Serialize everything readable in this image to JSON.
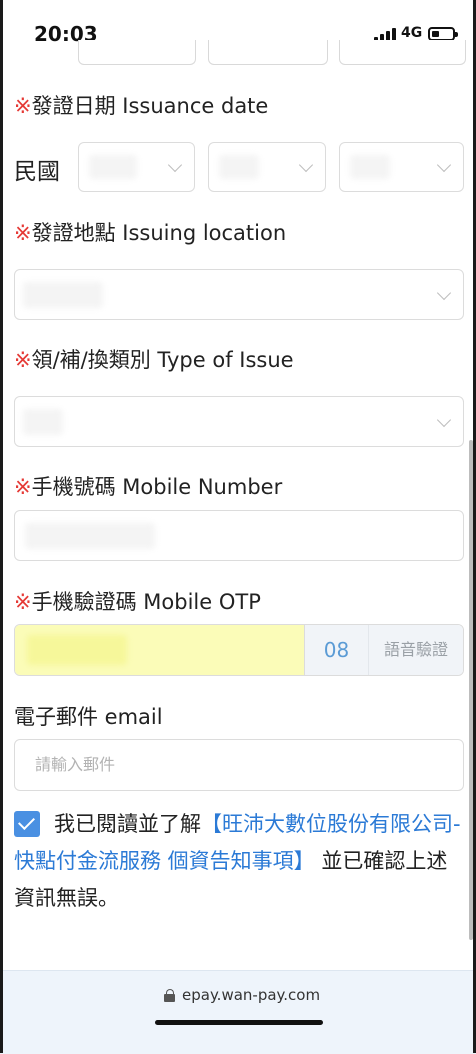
{
  "status_bar": {
    "time": "20:03",
    "network": "4G"
  },
  "form": {
    "issuance_date": {
      "required_mark": "※",
      "label": "發證日期 Issuance date",
      "era": "民國"
    },
    "issuing_location": {
      "required_mark": "※",
      "label": "發證地點 Issuing location"
    },
    "issue_type": {
      "required_mark": "※",
      "label": "領/補/換類別 Type of Issue"
    },
    "mobile_number": {
      "required_mark": "※",
      "label": "手機號碼 Mobile Number"
    },
    "mobile_otp": {
      "required_mark": "※",
      "label": "手機驗證碼 Mobile OTP",
      "countdown": "08",
      "voice_button": "語音驗證"
    },
    "email": {
      "label": "電子郵件 email",
      "placeholder": "請輸入郵件"
    },
    "consent": {
      "checked": true,
      "prefix": "我已閱讀並了解",
      "link": "【旺沛大數位股份有限公司-快點付金流服務 個資告知事項】",
      "suffix": " 並已確認上述資訊無誤。"
    }
  },
  "browser": {
    "url": "epay.wan-pay.com"
  },
  "colors": {
    "required": "#e53935",
    "link": "#2b7ad6",
    "checkbox": "#4a90e2",
    "otp_field": "#fbfcb8"
  }
}
